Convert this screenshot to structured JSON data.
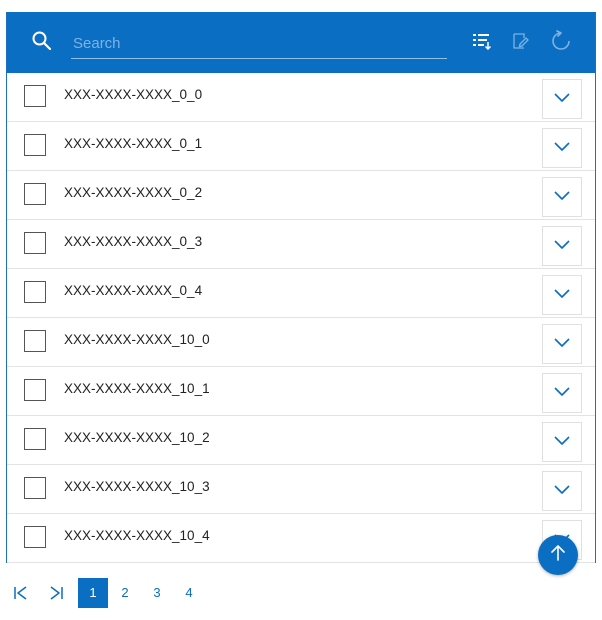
{
  "search": {
    "placeholder": "Search",
    "value": ""
  },
  "toolbar": {
    "icons": [
      "sort-list-icon",
      "edit-icon",
      "refresh-icon"
    ]
  },
  "rows": [
    {
      "label": "XXX-XXXX-XXXX_0_0",
      "checked": false
    },
    {
      "label": "XXX-XXXX-XXXX_0_1",
      "checked": false
    },
    {
      "label": "XXX-XXXX-XXXX_0_2",
      "checked": false
    },
    {
      "label": "XXX-XXXX-XXXX_0_3",
      "checked": false
    },
    {
      "label": "XXX-XXXX-XXXX_0_4",
      "checked": false
    },
    {
      "label": "XXX-XXXX-XXXX_10_0",
      "checked": false
    },
    {
      "label": "XXX-XXXX-XXXX_10_1",
      "checked": false
    },
    {
      "label": "XXX-XXXX-XXXX_10_2",
      "checked": false
    },
    {
      "label": "XXX-XXXX-XXXX_10_3",
      "checked": false
    },
    {
      "label": "XXX-XXXX-XXXX_10_4",
      "checked": false
    }
  ],
  "pagination": {
    "pages": [
      "1",
      "2",
      "3",
      "4"
    ],
    "current": "1"
  },
  "colors": {
    "accent": "#0a6ec2",
    "header_bg": "#0a6ec2",
    "divider": "#e3e3e3"
  }
}
